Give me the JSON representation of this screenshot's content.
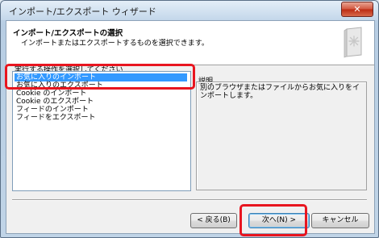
{
  "window": {
    "title": "インポート/エクスポート ウィザード",
    "close_glyph": "✕"
  },
  "header": {
    "title": "インポート/エクスポートの選択",
    "subtitle": "インポートまたはエクスポートするものを選択できます。"
  },
  "instruction": "実行する操作を選択してください",
  "actions": [
    {
      "label": "お気に入りのインポート",
      "selected": true
    },
    {
      "label": "お気に入りのエクスポート",
      "selected": false
    },
    {
      "label": "Cookie のインポート",
      "selected": false
    },
    {
      "label": "Cookie のエクスポート",
      "selected": false
    },
    {
      "label": "フィードのインポート",
      "selected": false
    },
    {
      "label": "フィードをエクスポート",
      "selected": false
    }
  ],
  "description": {
    "label": "説明",
    "text": "別のブラウザまたはファイルからお気に入りをインポートします。"
  },
  "buttons": {
    "back": "< 戻る(B)",
    "next": "次へ(N) >",
    "cancel": "キャンセル"
  },
  "colors": {
    "selection": "#3399ff",
    "highlight": "#e8151f"
  }
}
